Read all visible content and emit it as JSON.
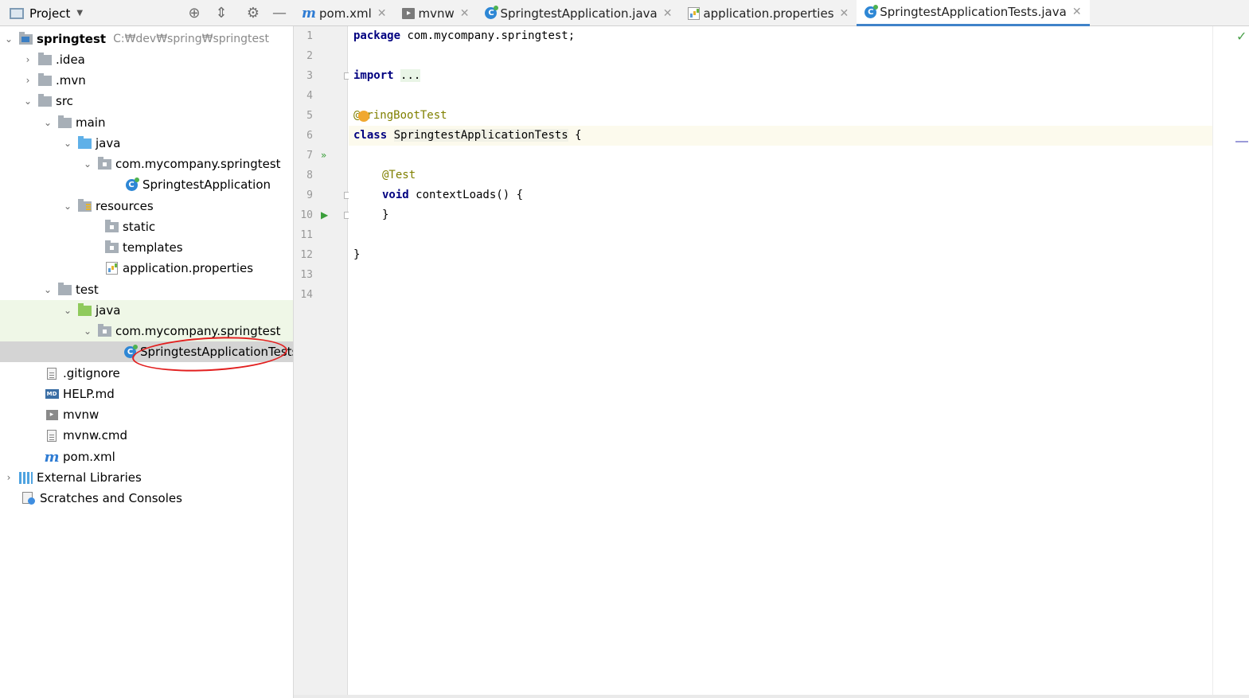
{
  "project_header": {
    "label": "Project"
  },
  "tabs": [
    {
      "label": "pom.xml",
      "icon": "maven-icon",
      "active": false
    },
    {
      "label": "mvnw",
      "icon": "shell-script-icon",
      "active": false
    },
    {
      "label": "SpringtestApplication.java",
      "icon": "java-class-icon",
      "active": false
    },
    {
      "label": "application.properties",
      "icon": "properties-file-icon",
      "active": false
    },
    {
      "label": "SpringtestApplicationTests.java",
      "icon": "java-class-icon",
      "active": true
    }
  ],
  "tree": {
    "root_name": "springtest",
    "root_path": "C:₩dev₩spring₩springtest",
    "idea": ".idea",
    "mvn": ".mvn",
    "src": "src",
    "main": "main",
    "main_java": "java",
    "main_pkg": "com.mycompany.springtest",
    "main_class": "SpringtestApplication",
    "resources": "resources",
    "static": "static",
    "templates": "templates",
    "app_props": "application.properties",
    "test": "test",
    "test_java": "java",
    "test_pkg": "com.mycompany.springtest",
    "test_class": "SpringtestApplicationTests",
    "gitignore": ".gitignore",
    "help": "HELP.md",
    "mvnw": "mvnw",
    "mvnw_cmd": "mvnw.cmd",
    "pom": "pom.xml",
    "ext_libs": "External Libraries",
    "scratches": "Scratches and Consoles"
  },
  "code": {
    "line_numbers": [
      "1",
      "2",
      "3",
      "4",
      "5",
      "6",
      "7",
      "8",
      "9",
      "10",
      "11",
      "12",
      "13",
      "14"
    ],
    "package_kw": "package",
    "package_name": " com.mycompany.springtest;",
    "import_kw": "import",
    "import_ellipsis": "...",
    "annotation_at": "@",
    "annotation_rest": "ringBootTest",
    "class_kw": "class",
    "class_name": "SpringtestApplicationTests",
    "class_brace": " {",
    "test_annotation": "@Test",
    "void_kw": "void",
    "method_sig": " contextLoads() {",
    "method_close": "}",
    "class_close": "}"
  },
  "colors": {
    "keyword": "#000080",
    "annotation": "#808000",
    "accent": "#4083c9",
    "highlight_marker": "#e21f1f"
  }
}
